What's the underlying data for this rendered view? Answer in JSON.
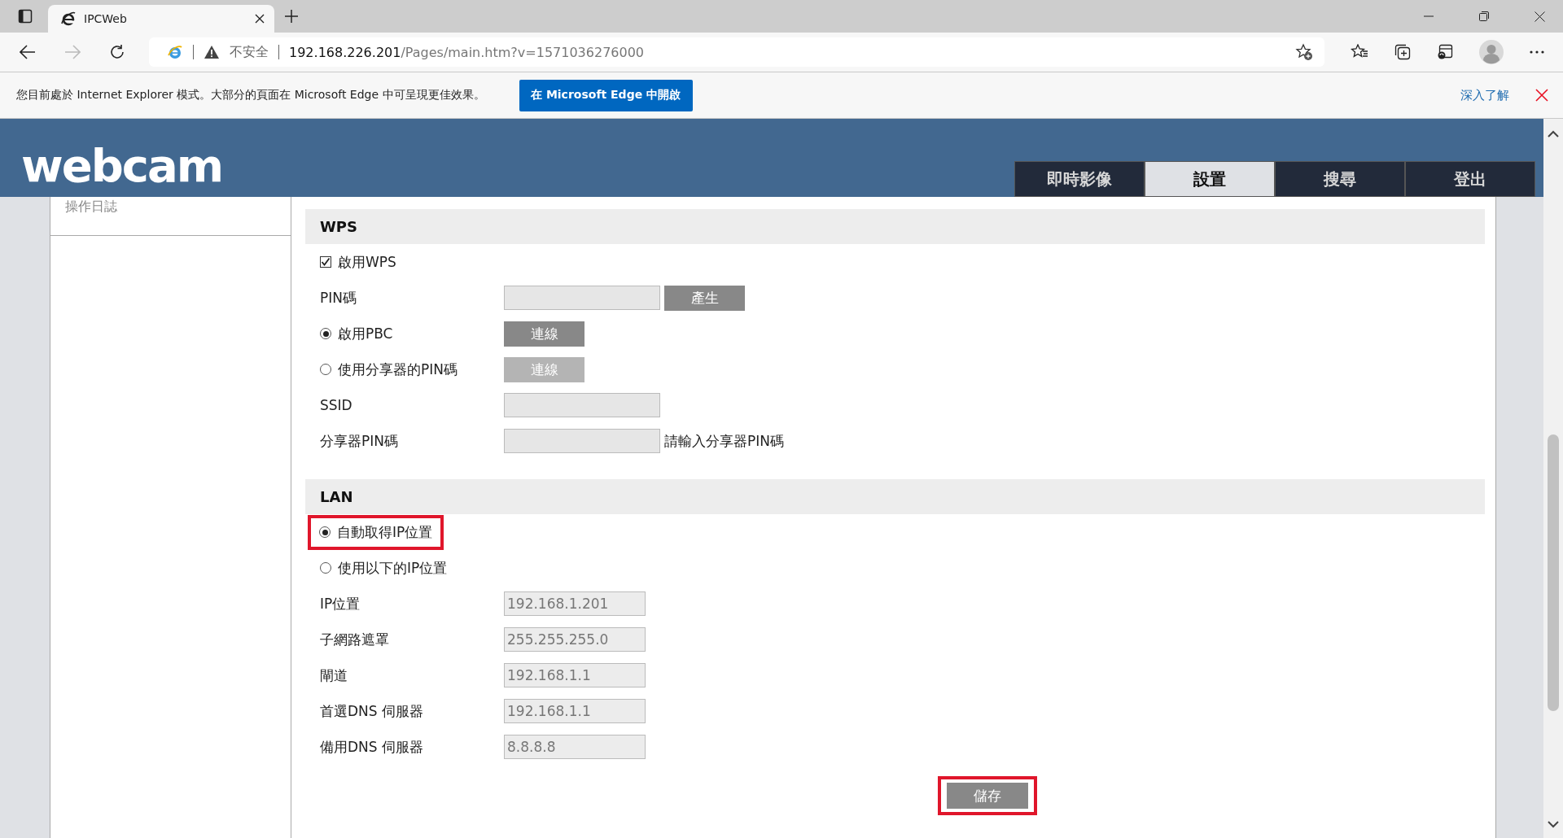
{
  "browser": {
    "tab_title": "IPCWeb",
    "security": "不安全",
    "url_host": "192.168.226.201",
    "url_path": "/Pages/main.htm?v=1571036276000"
  },
  "infobar": {
    "message": "您目前處於 Internet Explorer 模式。大部分的頁面在 Microsoft Edge 中可呈現更佳效果。",
    "button": "在 Microsoft Edge 中開啟",
    "link": "深入了解"
  },
  "header": {
    "logo": "webcam",
    "nav": [
      {
        "label": "即時影像",
        "selected": false
      },
      {
        "label": "設置",
        "selected": true
      },
      {
        "label": "搜尋",
        "selected": false
      },
      {
        "label": "登出",
        "selected": false
      }
    ]
  },
  "sidebar": {
    "items": [
      "操作日誌"
    ]
  },
  "wps": {
    "title": "WPS",
    "rows": [
      {
        "kind": "checkbox",
        "label": "啟用WPS",
        "checked": true
      },
      {
        "kind": "input",
        "label": "PIN碼",
        "button": {
          "label": "產生",
          "disabled": false
        }
      },
      {
        "kind": "radio",
        "label": "啟用PBC",
        "selected": true,
        "button": {
          "label": "連線",
          "disabled": false
        }
      },
      {
        "kind": "radio",
        "label": "使用分享器的PIN碼",
        "selected": false,
        "button": {
          "label": "連線",
          "disabled": true
        }
      },
      {
        "kind": "input",
        "label": "SSID"
      },
      {
        "kind": "input",
        "label": "分享器PIN碼",
        "note": "請輸入分享器PIN碼"
      }
    ]
  },
  "lan": {
    "title": "LAN",
    "rows": [
      {
        "kind": "radio",
        "label": "自動取得IP位置",
        "selected": true,
        "highlighted": true
      },
      {
        "kind": "radio",
        "label": "使用以下的IP位置",
        "selected": false,
        "highlighted": false
      },
      {
        "kind": "input",
        "label": "IP位置",
        "value": "192.168.1.201"
      },
      {
        "kind": "input",
        "label": "子網路遮罩",
        "value": "255.255.255.0"
      },
      {
        "kind": "input",
        "label": "閘道",
        "value": "192.168.1.1"
      },
      {
        "kind": "input",
        "label": "首選DNS 伺服器",
        "value": "192.168.1.1"
      },
      {
        "kind": "input",
        "label": "備用DNS 伺服器",
        "value": "8.8.8.8"
      }
    ]
  },
  "save_button": {
    "label": "儲存",
    "highlighted": true
  }
}
